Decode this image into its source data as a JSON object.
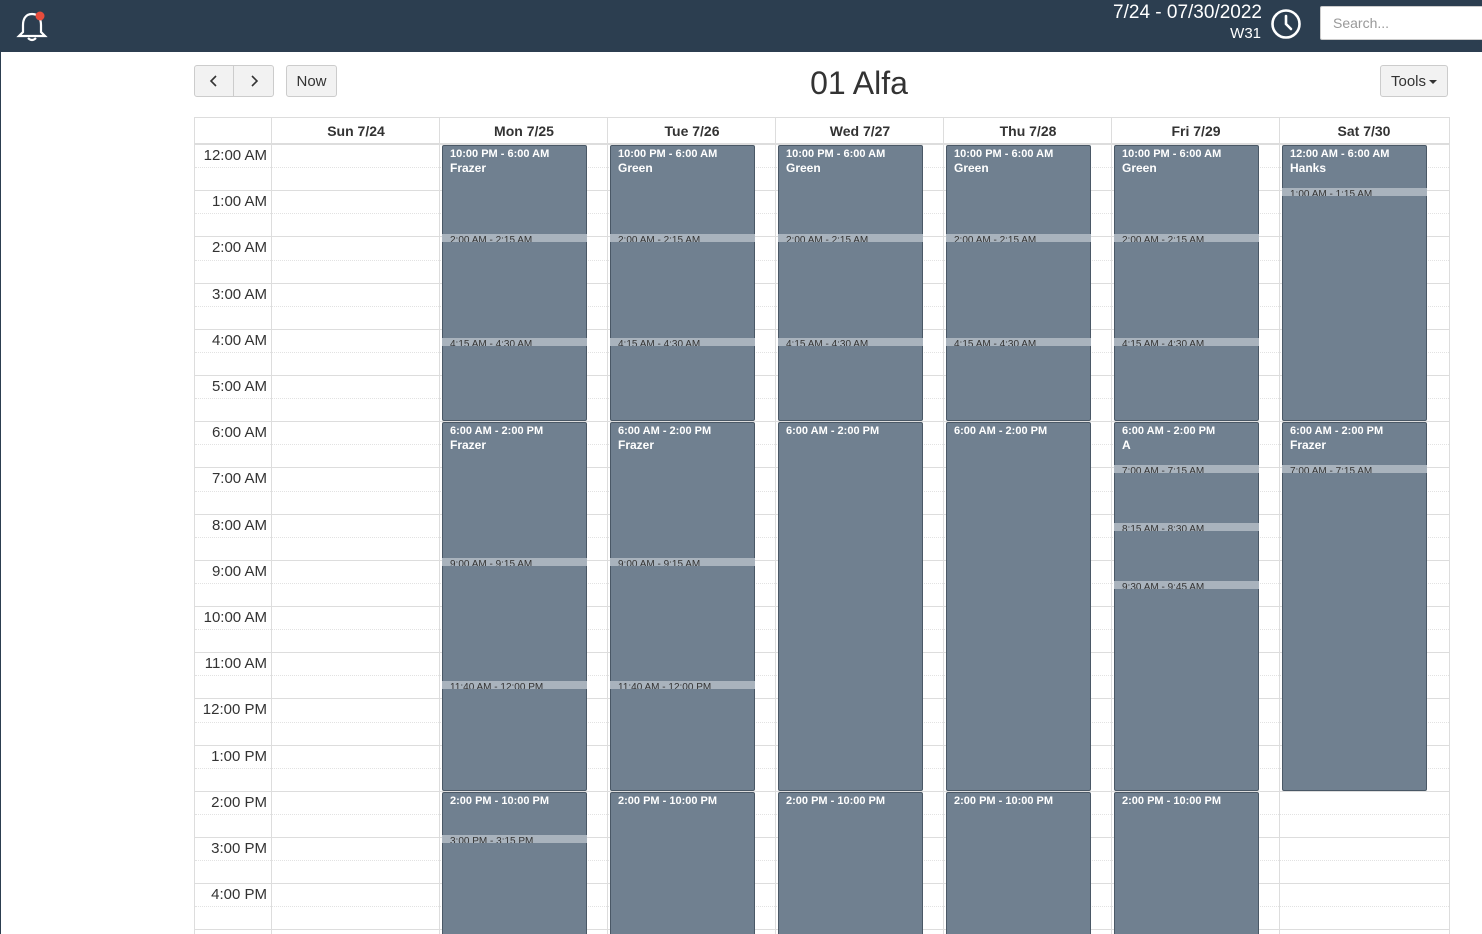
{
  "header": {
    "date_range": "7/24 - 07/30/2022",
    "week": "W31",
    "search_placeholder": "Search..."
  },
  "toolbar": {
    "prev_label": "‹",
    "next_label": "›",
    "now_label": "Now",
    "tools_label": "Tools",
    "title": "01 Alfa"
  },
  "calendar": {
    "days": [
      "Sun 7/24",
      "Mon 7/25",
      "Tue 7/26",
      "Wed 7/27",
      "Thu 7/28",
      "Fri 7/29",
      "Sat 7/30"
    ],
    "times": [
      "12:00 AM",
      "1:00 AM",
      "2:00 AM",
      "3:00 AM",
      "4:00 AM",
      "5:00 AM",
      "6:00 AM",
      "7:00 AM",
      "8:00 AM",
      "9:00 AM",
      "10:00 AM",
      "11:00 AM",
      "12:00 PM",
      "1:00 PM",
      "2:00 PM",
      "3:00 PM",
      "4:00 PM"
    ],
    "events": [
      {
        "day": 1,
        "start": 0,
        "end": 6,
        "time": "10:00 PM - 6:00 AM",
        "name": "Frazer"
      },
      {
        "day": 1,
        "start": 6,
        "end": 14,
        "time": "6:00 AM - 2:00 PM",
        "name": "Frazer"
      },
      {
        "day": 1,
        "start": 14,
        "end": 18,
        "time": "2:00 PM - 10:00 PM",
        "name": ""
      },
      {
        "day": 2,
        "start": 0,
        "end": 6,
        "time": "10:00 PM - 6:00 AM",
        "name": "Green"
      },
      {
        "day": 2,
        "start": 6,
        "end": 14,
        "time": "6:00 AM - 2:00 PM",
        "name": "Frazer"
      },
      {
        "day": 2,
        "start": 14,
        "end": 18,
        "time": "2:00 PM - 10:00 PM",
        "name": ""
      },
      {
        "day": 3,
        "start": 0,
        "end": 6,
        "time": "10:00 PM - 6:00 AM",
        "name": "Green"
      },
      {
        "day": 3,
        "start": 6,
        "end": 14,
        "time": "6:00 AM - 2:00 PM",
        "name": ""
      },
      {
        "day": 3,
        "start": 14,
        "end": 18,
        "time": "2:00 PM - 10:00 PM",
        "name": ""
      },
      {
        "day": 4,
        "start": 0,
        "end": 6,
        "time": "10:00 PM - 6:00 AM",
        "name": "Green"
      },
      {
        "day": 4,
        "start": 6,
        "end": 14,
        "time": "6:00 AM - 2:00 PM",
        "name": ""
      },
      {
        "day": 4,
        "start": 14,
        "end": 18,
        "time": "2:00 PM - 10:00 PM",
        "name": ""
      },
      {
        "day": 5,
        "start": 0,
        "end": 6,
        "time": "10:00 PM - 6:00 AM",
        "name": "Green"
      },
      {
        "day": 5,
        "start": 6,
        "end": 14,
        "time": "6:00 AM - 2:00 PM",
        "name": "A"
      },
      {
        "day": 5,
        "start": 14,
        "end": 18,
        "time": "2:00 PM - 10:00 PM",
        "name": ""
      },
      {
        "day": 6,
        "start": 0,
        "end": 6,
        "time": "12:00 AM - 6:00 AM",
        "name": "Hanks"
      },
      {
        "day": 6,
        "start": 6,
        "end": 14,
        "time": "6:00 AM - 2:00 PM",
        "name": "Frazer"
      }
    ],
    "breaks": [
      {
        "day": 1,
        "start": 2,
        "label": "2:00 AM - 2:15 AM"
      },
      {
        "day": 1,
        "start": 4.25,
        "label": "4:15 AM - 4:30 AM"
      },
      {
        "day": 1,
        "start": 9,
        "label": "9:00 AM - 9:15 AM"
      },
      {
        "day": 1,
        "start": 11.6667,
        "label": "11:40 AM - 12:00 PM"
      },
      {
        "day": 1,
        "start": 15,
        "label": "3:00 PM - 3:15 PM"
      },
      {
        "day": 2,
        "start": 2,
        "label": "2:00 AM - 2:15 AM"
      },
      {
        "day": 2,
        "start": 4.25,
        "label": "4:15 AM - 4:30 AM"
      },
      {
        "day": 2,
        "start": 9,
        "label": "9:00 AM - 9:15 AM"
      },
      {
        "day": 2,
        "start": 11.6667,
        "label": "11:40 AM - 12:00 PM"
      },
      {
        "day": 3,
        "start": 2,
        "label": "2:00 AM - 2:15 AM"
      },
      {
        "day": 3,
        "start": 4.25,
        "label": "4:15 AM - 4:30 AM"
      },
      {
        "day": 4,
        "start": 2,
        "label": "2:00 AM - 2:15 AM"
      },
      {
        "day": 4,
        "start": 4.25,
        "label": "4:15 AM - 4:30 AM"
      },
      {
        "day": 5,
        "start": 2,
        "label": "2:00 AM - 2:15 AM"
      },
      {
        "day": 5,
        "start": 4.25,
        "label": "4:15 AM - 4:30 AM"
      },
      {
        "day": 5,
        "start": 7,
        "label": "7:00 AM - 7:15 AM"
      },
      {
        "day": 5,
        "start": 8.25,
        "label": "8:15 AM - 8:30 AM"
      },
      {
        "day": 5,
        "start": 9.5,
        "label": "9:30 AM - 9:45 AM"
      },
      {
        "day": 6,
        "start": 1,
        "label": "1:00 AM - 1:15 AM"
      },
      {
        "day": 6,
        "start": 7,
        "label": "7:00 AM - 7:15 AM"
      }
    ]
  }
}
